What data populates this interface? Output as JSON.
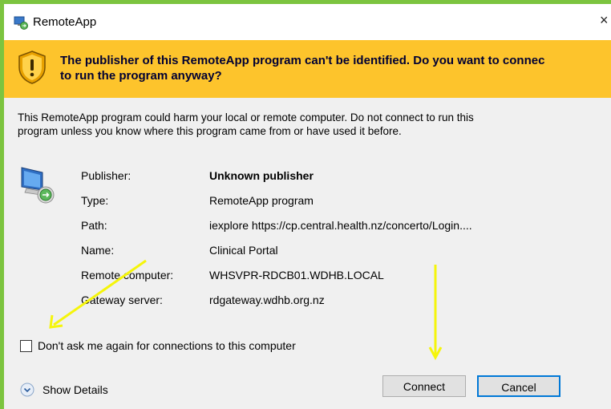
{
  "window": {
    "title": "RemoteApp",
    "close_glyph": "×"
  },
  "banner": {
    "line1": "The publisher of this RemoteApp program can't be identified. Do you want to connec",
    "line2": "to run the program anyway?",
    "icon": "warning-shield-icon"
  },
  "body": {
    "line1": "This RemoteApp program could harm your local or remote computer. Do not connect to run this",
    "line2": "program unless you know where this program came from or have used it before."
  },
  "details": [
    {
      "label": "Publisher:",
      "value": "Unknown publisher"
    },
    {
      "label": "Type:",
      "value": "RemoteApp program"
    },
    {
      "label": "Path:",
      "value": "iexplore https://cp.central.health.nz/concerto/Login...."
    },
    {
      "label": "Name:",
      "value": "Clinical Portal"
    },
    {
      "label": "Remote computer:",
      "value": "WHSVPR-RDCB01.WDHB.LOCAL"
    },
    {
      "label": "Gateway server:",
      "value": "rdgateway.wdhb.org.nz"
    }
  ],
  "checkbox": {
    "label": "Don't ask me again for connections to this computer",
    "checked": false
  },
  "footer": {
    "show_details": "Show Details",
    "connect": "Connect",
    "cancel": "Cancel"
  },
  "colors": {
    "banner_bg": "#fdc42c",
    "outer_frame": "#7cc43f",
    "focus_border": "#0078d7",
    "annotation_arrow": "#f5f50a"
  }
}
